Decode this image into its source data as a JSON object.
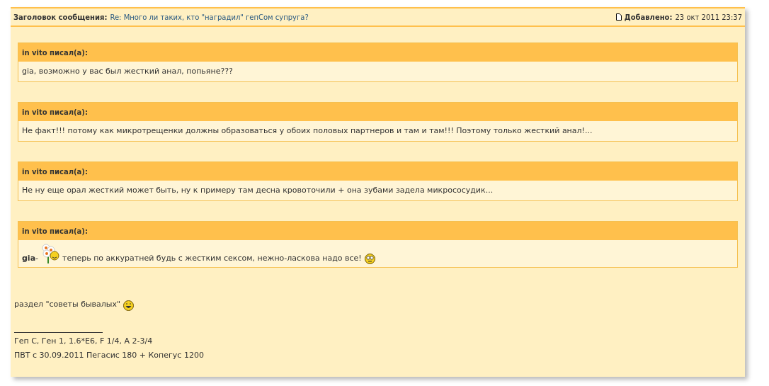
{
  "post": {
    "subject_label": "Заголовок сообщения:",
    "subject": "Re: Много ли таких, кто \"наградил\" гепСом супруга?",
    "added_label": "Добавлено:",
    "added": "23 окт 2011 23:37"
  },
  "quotes": [
    {
      "author": "in vito писал(а):",
      "body": [
        {
          "kind": "text",
          "text": "gia, возможно у вас был жесткий анал, попьяне???"
        }
      ]
    },
    {
      "author": "in vito писал(а):",
      "body": [
        {
          "kind": "text",
          "text": "Не факт!!! потому как микротрещенки должны образоваться у обоих половых партнеров и там и там!!! Поэтому только жесткий анал!..."
        }
      ]
    },
    {
      "author": "in vito писал(а):",
      "body": [
        {
          "kind": "text",
          "text": "Не ну еще орал жесткий может быть, ну к примеру там десна кровоточили + она зубами задела микрососудик..."
        }
      ]
    },
    {
      "author": "in vito писал(а):",
      "body": [
        {
          "kind": "text",
          "text": "**gia**-"
        },
        {
          "kind": "flower"
        },
        {
          "kind": "text",
          "text": "теперь по аккуратней будь с жестким сексом, нежно-ласкова надо все!"
        },
        {
          "kind": "rolleyes"
        }
      ]
    }
  ],
  "reply": [
    {
      "kind": "text",
      "text": "раздел \"советы бывалых\""
    },
    {
      "kind": "grin"
    }
  ],
  "signature": [
    "Геп С, Ген 1, 1.6*Е6, F 1/4, A 2-3/4",
    "ПВТ с 30.09.2011 Пегасис 180 + Копегус 1200"
  ]
}
